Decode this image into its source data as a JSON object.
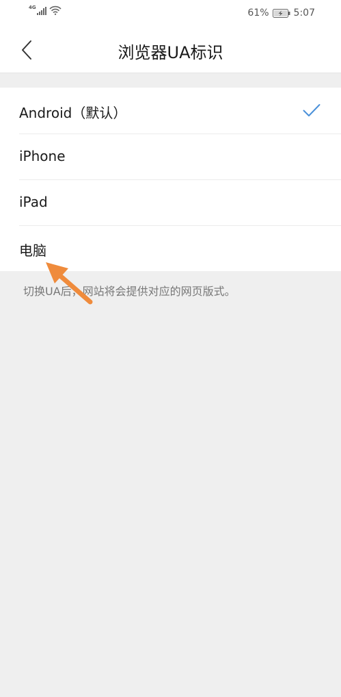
{
  "status_bar": {
    "network_label": "4G",
    "battery_percent": "61%",
    "time": "5:07"
  },
  "header": {
    "title": "浏览器UA标识",
    "back_icon": "chevron-left-icon"
  },
  "options": [
    {
      "label": "Android（默认）",
      "selected": true
    },
    {
      "label": "iPhone",
      "selected": false
    },
    {
      "label": "iPad",
      "selected": false
    },
    {
      "label": "电脑",
      "selected": false
    }
  ],
  "hint": "切换UA后，网站将会提供对应的网页版式。",
  "colors": {
    "accent": "#4a90d9",
    "annotation": "#ef8b3c",
    "background": "#efefef"
  }
}
